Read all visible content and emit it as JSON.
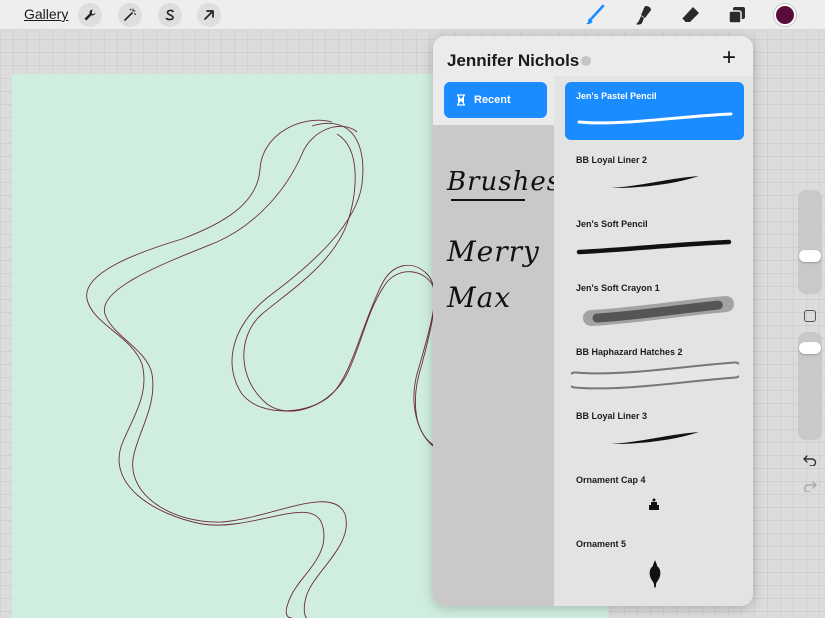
{
  "toolbar": {
    "gallery_label": "Gallery",
    "left_icons": [
      "wrench-icon",
      "magic-wand-icon",
      "selection-s-icon",
      "transform-arrow-icon"
    ],
    "right_tools": [
      "brush-icon",
      "smudge-icon",
      "eraser-icon",
      "layers-icon"
    ],
    "active_tool": "brush-icon",
    "current_color": "#5a0c3a",
    "accent": "#1a8cff"
  },
  "brush_library": {
    "title": "Jennifer Nichols",
    "add_label": "+",
    "sets": [
      {
        "label": "Recent",
        "icon": "hourglass-icon",
        "selected": true
      },
      {
        "label": "Brushes",
        "handwritten": true
      },
      {
        "label": "Merry",
        "handwritten": true
      },
      {
        "label": "Max",
        "handwritten": true
      }
    ],
    "brushes": [
      {
        "name": "Jen's Pastel Pencil",
        "selected": true
      },
      {
        "name": "BB  Loyal Liner 2"
      },
      {
        "name": "Jen's Soft Pencil"
      },
      {
        "name": "Jen's Soft Crayon 1"
      },
      {
        "name": "BB  Haphazard Hatches 2"
      },
      {
        "name": "BB  Loyal Liner 3"
      },
      {
        "name": "Ornament Cap 4"
      },
      {
        "name": "Ornament 5"
      }
    ]
  },
  "sidebar": {
    "brush_size_level": 0.35,
    "opacity_level": 0.1
  },
  "canvas": {
    "background_color": "#d0eedf",
    "stroke_color": "#6b2a3e"
  }
}
